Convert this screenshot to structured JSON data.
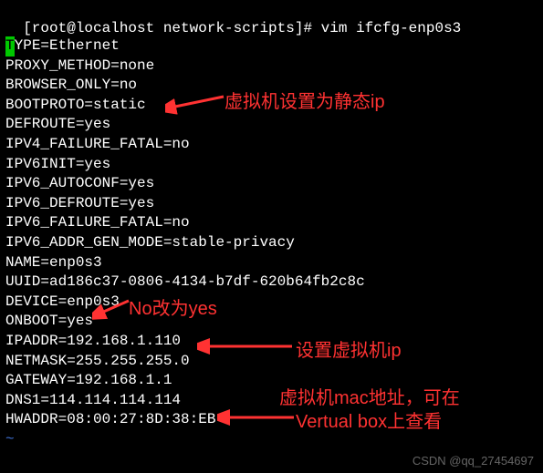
{
  "top_fragment": "",
  "prompt": "[root@localhost network-scripts]# vim ifcfg-enp0s3",
  "lines": [
    "TYPE=Ethernet",
    "PROXY_METHOD=none",
    "BROWSER_ONLY=no",
    "BOOTPROTO=static",
    "DEFROUTE=yes",
    "IPV4_FAILURE_FATAL=no",
    "IPV6INIT=yes",
    "IPV6_AUTOCONF=yes",
    "IPV6_DEFROUTE=yes",
    "IPV6_FAILURE_FATAL=no",
    "IPV6_ADDR_GEN_MODE=stable-privacy",
    "NAME=enp0s3",
    "UUID=ad186c37-0806-4134-b7df-620b64fb2c8c",
    "DEVICE=enp0s3",
    "ONBOOT=yes",
    "IPADDR=192.168.1.110",
    "NETMASK=255.255.255.0",
    "GATEWAY=192.168.1.1",
    "DNS1=114.114.114.114",
    "HWADDR=08:00:27:8D:38:EB"
  ],
  "tilde": "~",
  "annotations": {
    "a1": "虚拟机设置为静态ip",
    "a2": "No改为yes",
    "a3": "设置虚拟机ip",
    "a4_line1": "虚拟机mac地址，可在",
    "a4_line2": "Vertual box上查看"
  },
  "watermark": "CSDN @qq_27454697"
}
